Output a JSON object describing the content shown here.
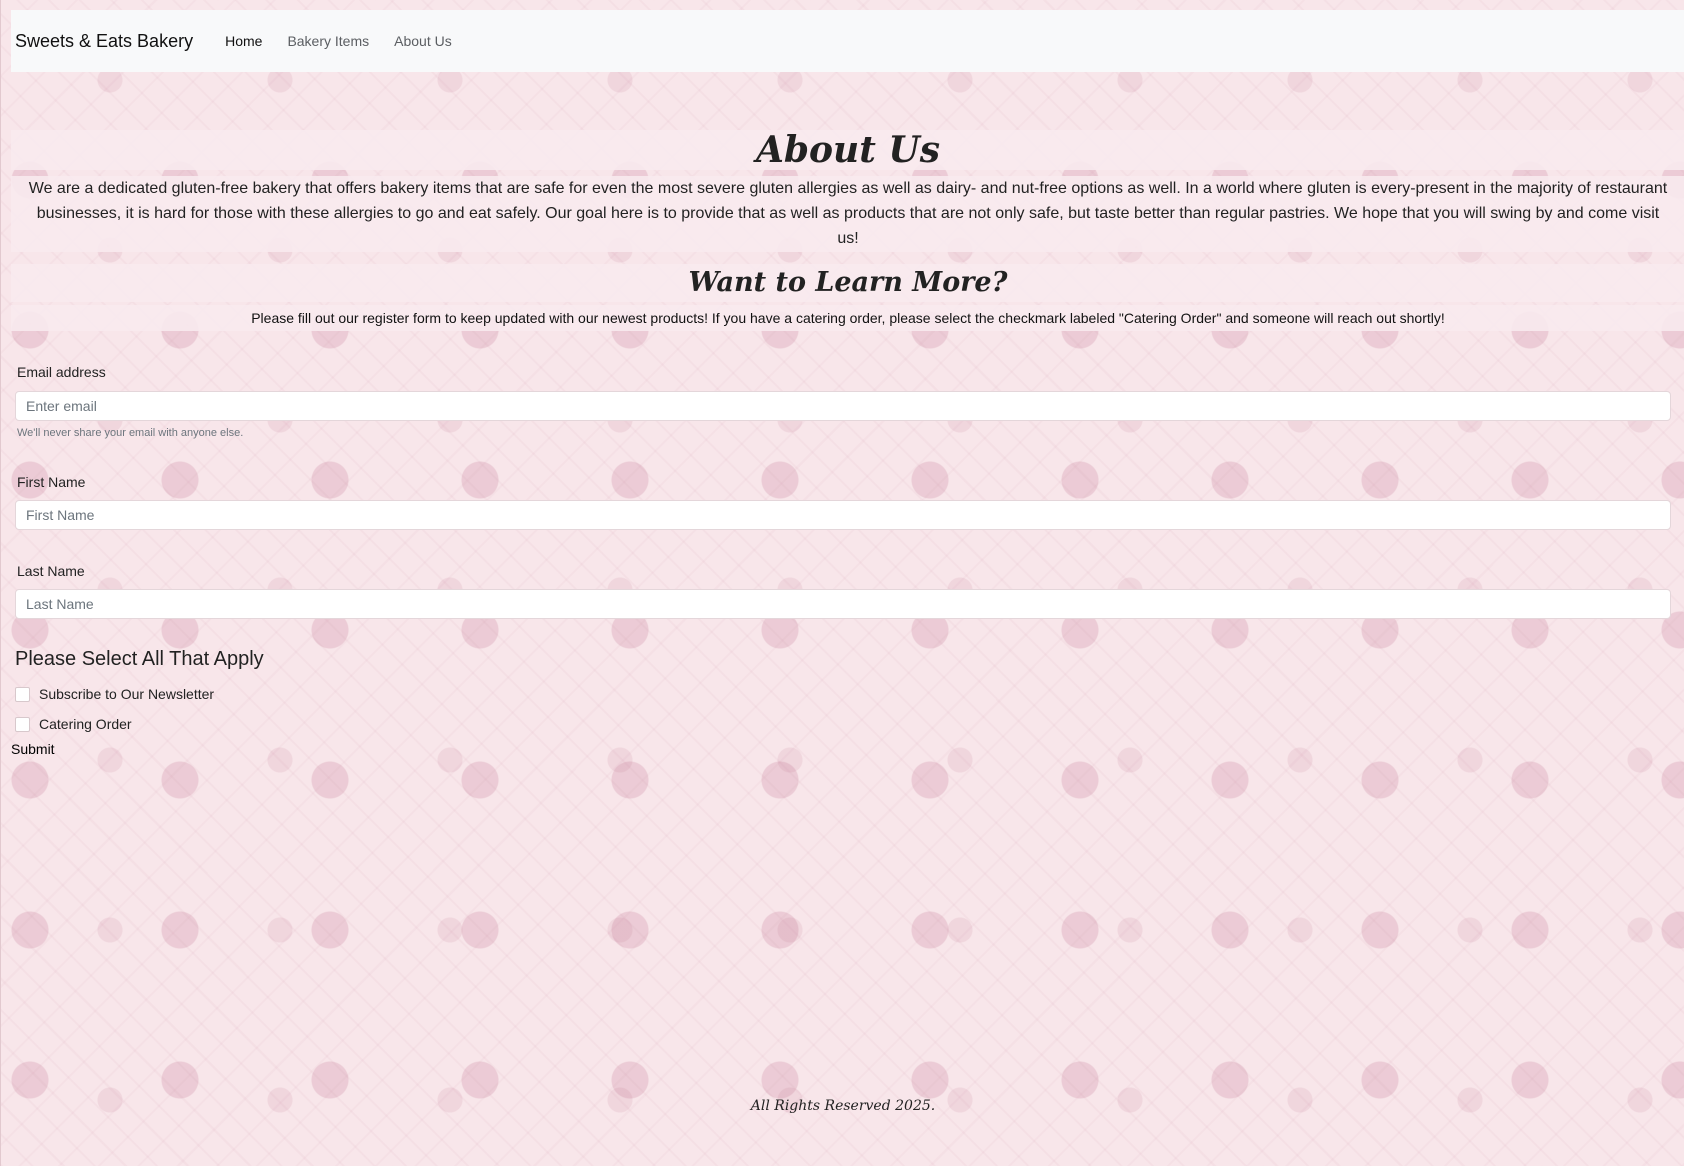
{
  "navbar": {
    "brand": "Sweets & Eats Bakery",
    "links": [
      {
        "label": "Home",
        "active": true
      },
      {
        "label": "Bakery Items",
        "active": false
      },
      {
        "label": "About Us",
        "active": false
      }
    ]
  },
  "about": {
    "title": "About Us",
    "text": "We are a dedicated gluten-free bakery that offers bakery items that are safe for even the most severe gluten allergies as well as dairy- and nut-free options as well. In a world where gluten is every-present in the majority of restaurant businesses, it is hard for those with these allergies to go and eat safely. Our goal here is to provide that as well as products that are not only safe, but taste better than regular pastries. We hope that you will swing by and come visit us!"
  },
  "learn_more": {
    "title": "Want to Learn More?",
    "text": "Please fill out our register form to keep updated with our newest products! If you have a catering order, please select the checkmark labeled \"Catering Order\" and someone will reach out shortly!"
  },
  "form": {
    "email": {
      "label": "Email address",
      "placeholder": "Enter email",
      "help": "We'll never share your email with anyone else."
    },
    "first_name": {
      "label": "First Name",
      "placeholder": "First Name"
    },
    "last_name": {
      "label": "Last Name",
      "placeholder": "Last Name"
    },
    "checks_title": "Please Select All That Apply",
    "checks": [
      {
        "label": "Subscribe to Our Newsletter",
        "checked": false
      },
      {
        "label": "Catering Order",
        "checked": false
      }
    ],
    "submit_label": "Submit"
  },
  "footer": {
    "text": "All Rights Reserved 2025."
  }
}
